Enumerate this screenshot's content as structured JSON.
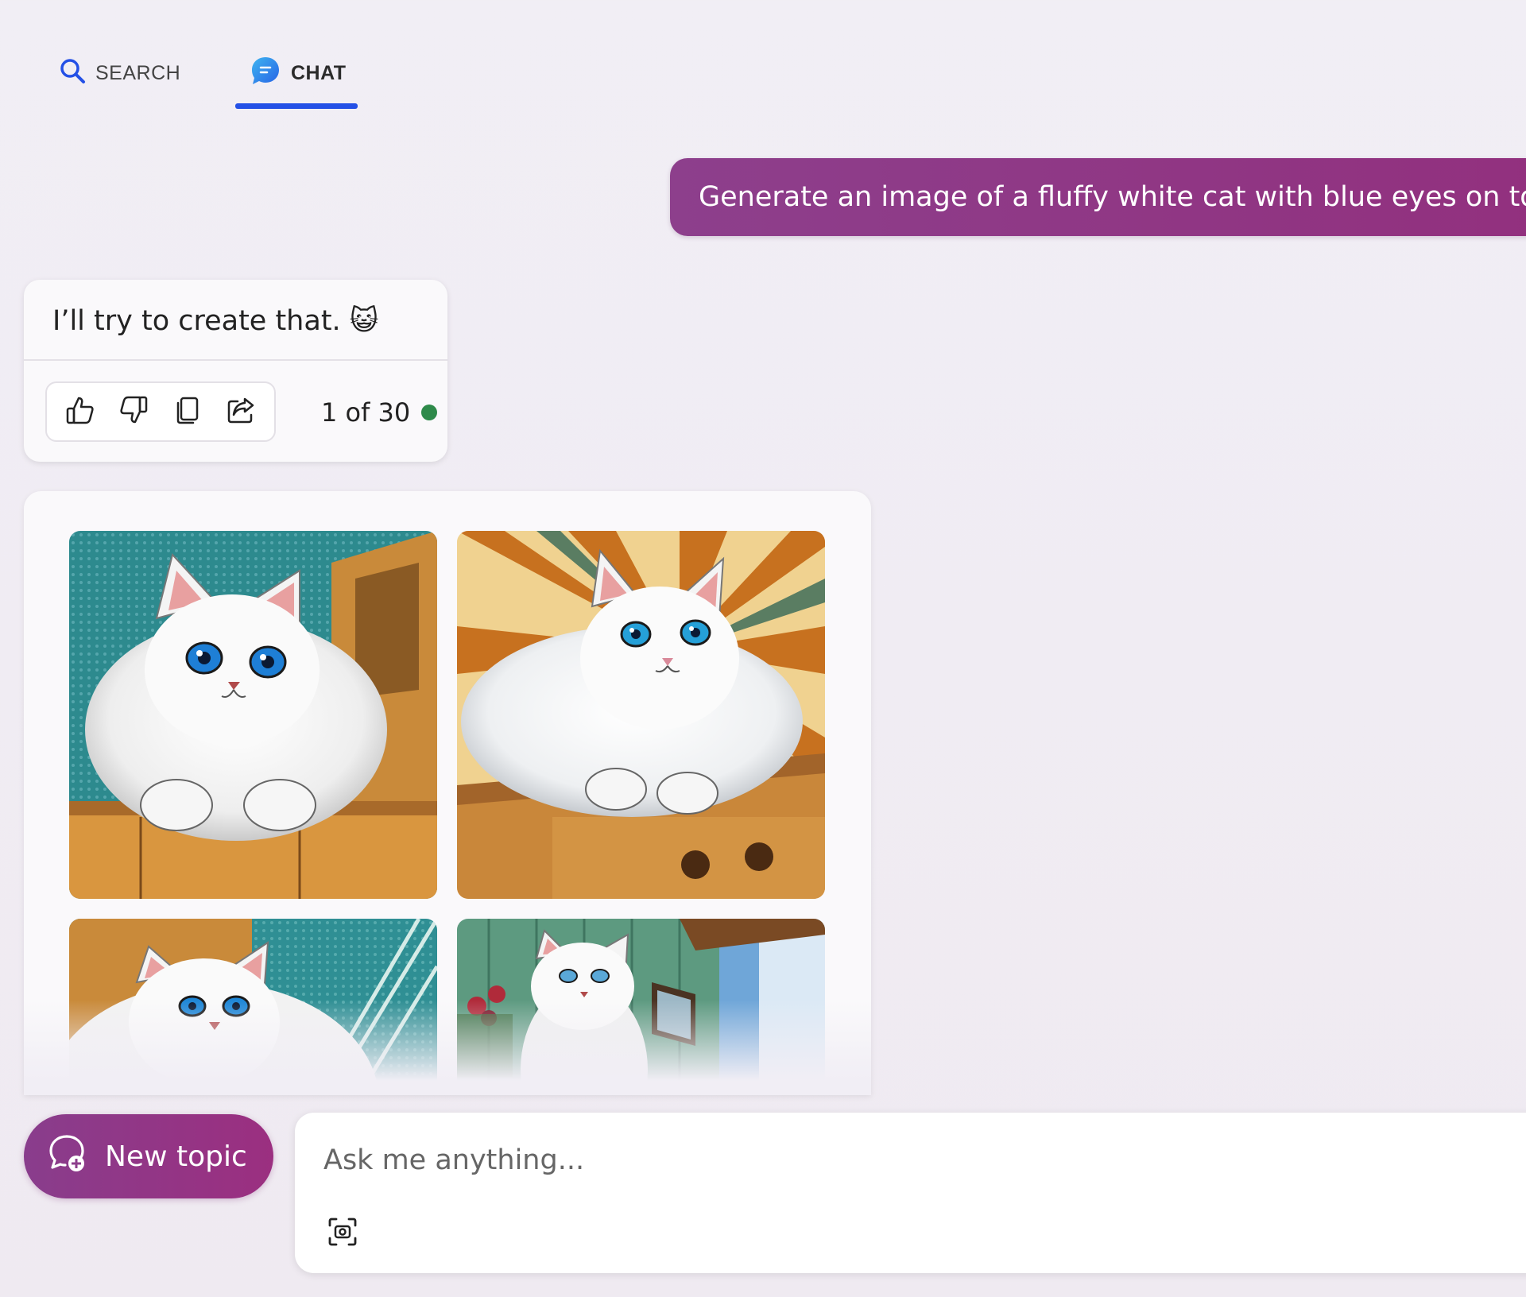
{
  "tabs": {
    "search": {
      "label": "SEARCH",
      "icon": "search-icon"
    },
    "chat": {
      "label": "CHAT",
      "icon": "chat-bubble-icon",
      "active": true
    }
  },
  "user_message": {
    "text": "Generate an image of a fluffy white cat with blue eyes on top of a"
  },
  "bot_message": {
    "text": "I’ll try to create that. 😺",
    "actions": [
      {
        "name": "like",
        "icon": "thumbs-up-icon"
      },
      {
        "name": "dislike",
        "icon": "thumbs-down-icon"
      },
      {
        "name": "copy",
        "icon": "copy-icon"
      },
      {
        "name": "share",
        "icon": "share-icon"
      }
    ],
    "counter": "1 of 30",
    "status_color": "#2e8a4a"
  },
  "image_results": {
    "images": [
      {
        "name": "cat-image-1"
      },
      {
        "name": "cat-image-2"
      },
      {
        "name": "cat-image-3"
      },
      {
        "name": "cat-image-4"
      }
    ]
  },
  "bottom_bar": {
    "new_topic_label": "New topic",
    "input_placeholder": "Ask me anything...",
    "visual_search_icon": "visual-search-icon"
  },
  "colors": {
    "accent": "#2450e6",
    "user_bubble": "#8d3f8c",
    "new_topic": "#893d8c",
    "background": "#f1eef5"
  }
}
